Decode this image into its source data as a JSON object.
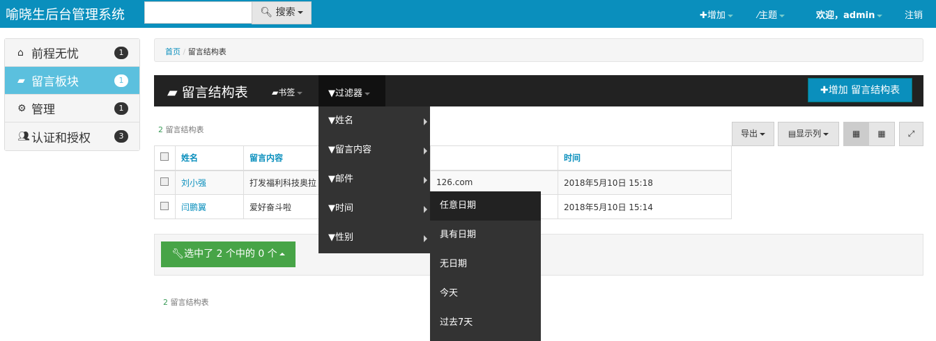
{
  "header": {
    "brand": "喻晓生后台管理系统",
    "search_placeholder": "",
    "search_label": "搜索",
    "add": "增加",
    "theme": "主题",
    "welcome": "欢迎，",
    "user": "admin",
    "logout": "注销"
  },
  "sidebar": {
    "items": [
      {
        "label": "前程无忧",
        "badge": "1",
        "icon": "home-icon"
      },
      {
        "label": "留言板块",
        "badge": "1",
        "icon": "book-icon"
      },
      {
        "label": "管理",
        "badge": "1",
        "icon": "gear-icon"
      },
      {
        "label": "认证和授权",
        "badge": "3",
        "icon": "users-icon"
      }
    ]
  },
  "breadcrumb": {
    "home": "首页",
    "sep": "/",
    "current": "留言结构表"
  },
  "panel": {
    "title": "留言结构表",
    "bookmarks": "书签",
    "filter": "过滤器",
    "add_button": "增加 留言结构表"
  },
  "count": {
    "n": "2",
    "label": "留言结构表"
  },
  "toolbar": {
    "export": "导出",
    "columns": "显示列"
  },
  "table": {
    "headers": [
      "姓名",
      "留言内容",
      "",
      "时间"
    ],
    "rows": [
      {
        "name": "刘小强",
        "content": "打发福利科技奥拉",
        "email": "126.com",
        "time": "2018年5月10日 15:18"
      },
      {
        "name": "闫鹏翼",
        "content": "爱好奋斗啦",
        "email": "",
        "time": "2018年5月10日 15:14"
      }
    ]
  },
  "action": {
    "selected": "选中了 2 个中的 0 个"
  },
  "filter_menu": {
    "items": [
      "姓名",
      "留言内容",
      "邮件",
      "时间",
      "性别"
    ]
  },
  "time_submenu": {
    "items": [
      "任意日期",
      "具有日期",
      "无日期",
      "今天",
      "过去7天"
    ]
  },
  "colors": {
    "primary": "#0a8fbd",
    "dark": "#222222",
    "success": "#47a447",
    "info": "#5bc0de"
  }
}
